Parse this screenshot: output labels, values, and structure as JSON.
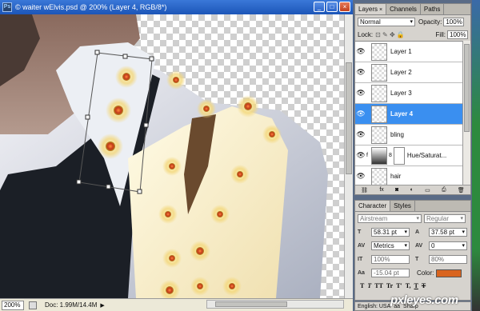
{
  "doc_window": {
    "title": "© waiter wElvis.psd @ 200% (Layer 4, RGB/8*)",
    "ps_icon": "Ps",
    "min": "_",
    "max": "□",
    "close": "×"
  },
  "status": {
    "zoom": "200%",
    "doc_size": "Doc: 1.99M/14.4M",
    "arrow": "▶"
  },
  "layers_panel": {
    "tabs": [
      {
        "label": "Layers"
      },
      {
        "label": "Channels"
      },
      {
        "label": "Paths"
      }
    ],
    "tab_close": "×",
    "blend_mode": "Normal",
    "opacity_label": "Opacity:",
    "opacity": "100%",
    "lock_label": "Lock:",
    "lock_icons": "⊡ ✎ ✥ 🔒",
    "fill_label": "Fill:",
    "fill": "100%",
    "layers": [
      {
        "name": "Layer 1"
      },
      {
        "name": "Layer 2"
      },
      {
        "name": "Layer 3"
      },
      {
        "name": "Layer 4"
      },
      {
        "name": "bling"
      },
      {
        "name": "Hue/Saturat..."
      },
      {
        "name": "hair"
      }
    ],
    "footer_icons": [
      "⛓",
      "fx",
      "◙",
      "◐",
      "▭",
      "⎙",
      "🗑"
    ]
  },
  "char_panel": {
    "tabs": [
      {
        "label": "Character"
      },
      {
        "label": "Styles"
      }
    ],
    "font_family": "Airstream",
    "font_style": "Regular",
    "font_size": "58.31 pt",
    "leading": "37.58 pt",
    "kerning": "Metrics",
    "tracking": "0",
    "vscale": "100%",
    "hscale": "80%",
    "baseline": "-15.04 pt",
    "color_label": "Color:",
    "color": "#d9641e",
    "icon_size": "T",
    "icon_leading": "A",
    "icon_kerning": "AV",
    "icon_tracking": "AV",
    "icon_vscale": "IT",
    "icon_hscale": "T",
    "icon_baseline": "Aa",
    "style_buttons": [
      "T",
      "T",
      "TT",
      "Tr",
      "T'",
      "T,",
      "T",
      "T"
    ]
  },
  "lang_bar": {
    "language": "English: USA",
    "aa": "aa",
    "antialias": "Sharp"
  },
  "watermark": "pxleyes.com"
}
